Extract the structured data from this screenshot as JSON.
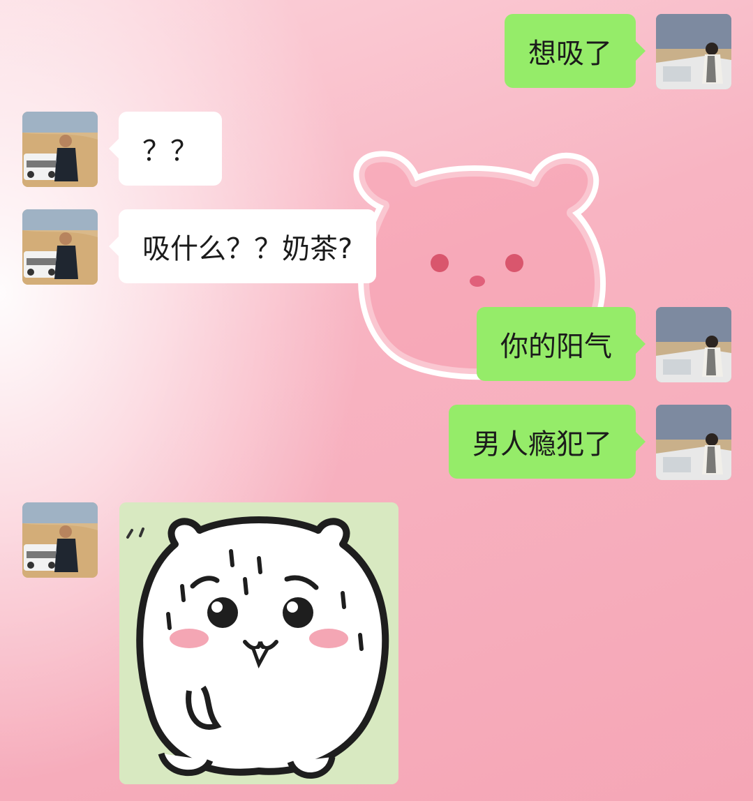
{
  "chat": {
    "messages": [
      {
        "side": "right",
        "type": "text",
        "text": "想吸了"
      },
      {
        "side": "left",
        "type": "text",
        "text": "？？"
      },
      {
        "side": "left",
        "type": "text",
        "text": "吸什么？？奶茶?"
      },
      {
        "side": "right",
        "type": "text",
        "text": "你的阳气"
      },
      {
        "side": "right",
        "type": "text",
        "text": "男人瘾犯了"
      },
      {
        "side": "left",
        "type": "sticker",
        "sticker": "sweating-hamster-sticker"
      }
    ]
  },
  "theme": {
    "sent_bubble": "#95ec69",
    "received_bubble": "#ffffff",
    "background": "#f7a9b8"
  },
  "icons": {
    "background_decoration": "bear-face-outline",
    "self_avatar": "girl-by-car-avatar",
    "other_avatar": "man-by-jeep-avatar"
  }
}
